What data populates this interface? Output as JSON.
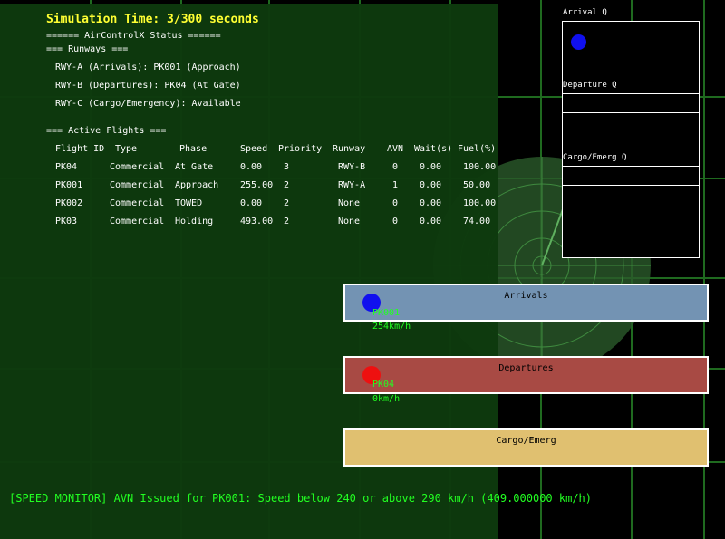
{
  "header": {
    "sim_time": "Simulation Time: 3/300 seconds",
    "status_title": "====== AirControlX Status ======",
    "runways_header": "=== Runways ===",
    "flights_header": "=== Active Flights ==="
  },
  "runways": [
    "RWY-A (Arrivals): PK001 (Approach)",
    "RWY-B (Departures): PK04 (At Gate)",
    "RWY-C (Cargo/Emergency): Available"
  ],
  "flights": {
    "columns": [
      "Flight ID",
      "Type",
      "Phase",
      "Speed",
      "Priority",
      "Runway",
      "AVN",
      "Wait(s)",
      "Fuel(%)"
    ],
    "rows": [
      [
        "PK04",
        "Commercial",
        "At Gate",
        "0.00",
        "3",
        "RWY-B",
        "0",
        "0.00",
        "100.00"
      ],
      [
        "PK001",
        "Commercial",
        "Approach",
        "255.00",
        "2",
        "RWY-A",
        "1",
        "0.00",
        "50.00"
      ],
      [
        "PK002",
        "Commercial",
        "TOWED",
        "0.00",
        "2",
        "None",
        "0",
        "0.00",
        "100.00"
      ],
      [
        "PK03",
        "Commercial",
        "Holding",
        "493.00",
        "2",
        "None",
        "0",
        "0.00",
        "74.00"
      ]
    ]
  },
  "queues": {
    "arrival_label": "Arrival Q",
    "departure_label": "Departure Q",
    "cargo_label": "Cargo/Emerg Q"
  },
  "runway_strips": {
    "arrivals": {
      "label": "Arrivals",
      "color": "#7393b3"
    },
    "departures": {
      "label": "Departures",
      "color": "#a84a44"
    },
    "cargo": {
      "label": "Cargo/Emerg",
      "color": "#e0c070"
    }
  },
  "planes": {
    "arrival_plane": {
      "id": "PK001",
      "speed": "254km/h",
      "color": "#1010ee"
    },
    "departure_plane": {
      "id": "PK04",
      "speed": "0km/h",
      "color": "#ee1010"
    },
    "arrival_queue_dot_color": "#1010ee"
  },
  "monitor": {
    "message": "[SPEED MONITOR] AVN Issued for PK001: Speed below 240 or above 290 km/h (409.000000 km/h)"
  },
  "colors": {
    "background": "#000000",
    "panel": "#0d3a0d",
    "grid": "#1f6a1f",
    "accent_text": "#ffff33",
    "monitor_text": "#22ff22"
  }
}
